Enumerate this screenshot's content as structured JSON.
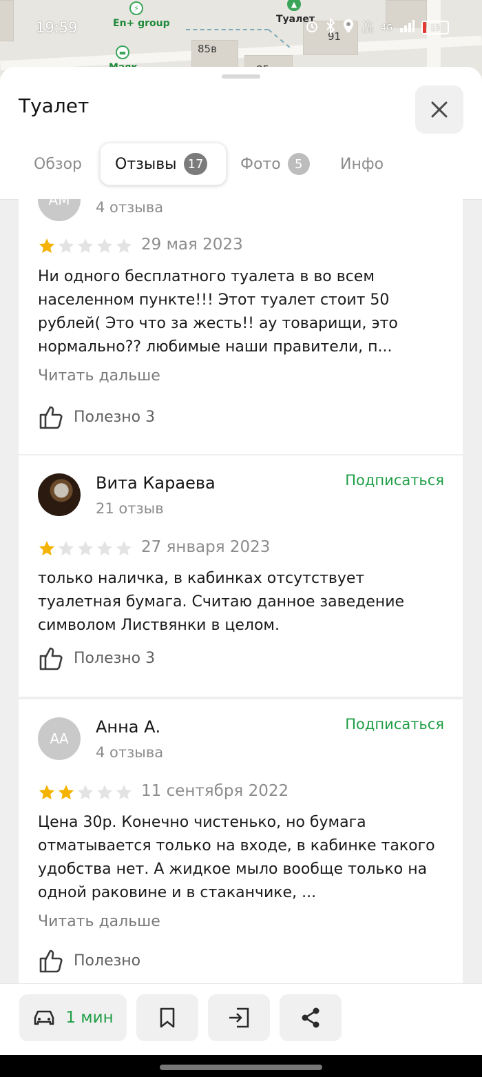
{
  "status_bar": {
    "time": "19:59",
    "network": "4G",
    "volte": "Vo LTE",
    "battery": "13",
    "battery_level": 0.13,
    "icons": [
      "alarm-icon",
      "bluetooth-icon",
      "location-icon",
      "volte-icon",
      "signal-icon",
      "battery-icon"
    ]
  },
  "map": {
    "labels": [
      "En+ group",
      "Туалет",
      "85в",
      "91",
      "Маяк",
      "85"
    ]
  },
  "sheet": {
    "title": "Туалет",
    "close_icon": "close-icon"
  },
  "tabs": [
    {
      "label": "Обзор",
      "badge": null,
      "active": false
    },
    {
      "label": "Отзывы",
      "badge": "17",
      "active": true
    },
    {
      "label": "Фото",
      "badge": "5",
      "active": false
    },
    {
      "label": "Инфо",
      "badge": null,
      "active": false
    }
  ],
  "reviews": [
    {
      "initials": "АМ",
      "name": "",
      "count": "4 отзыва",
      "rating": 1,
      "date": "29 мая 2023",
      "text": "Ни одного бесплатного туалета в во всем населенном пункте!!! Этот туалет стоит 50 рублей( Это что за жесть!! ау товарищи, это нормально?? любимые наши правители, п...",
      "more": "Читать дальше",
      "useful": "Полезно 3",
      "subscribe": ""
    },
    {
      "initials": "",
      "name": "Вита Караева",
      "count": "21 отзыв",
      "rating": 1,
      "date": "27 января 2023",
      "text": "только наличка, в кабинках отсутствует туалетная бумага. Считаю данное заведение символом Листвянки в целом.",
      "more": "",
      "useful": "Полезно 3",
      "subscribe": "Подписаться"
    },
    {
      "initials": "АА",
      "name": "Анна А.",
      "count": "4 отзыва",
      "rating": 2,
      "date": "11 сентября 2022",
      "text": "Цена 30р. Конечно чистенько, но бумага отматывается только на входе, в кабинке такого удобства нет. А жидкое мыло вообще только на одной раковине и в стаканчике, ...",
      "more": "Читать дальше",
      "useful": "Полезно",
      "subscribe": "Подписаться"
    }
  ],
  "bottom_bar": {
    "route_time": "1 мин",
    "buttons": [
      "car-icon",
      "bookmark-icon",
      "entrance-icon",
      "share-icon"
    ]
  },
  "colors": {
    "accent_green": "#1f9e45",
    "star_filled": "#f5b301",
    "star_empty": "#e3e3e3",
    "battery_low": "#e53935"
  }
}
